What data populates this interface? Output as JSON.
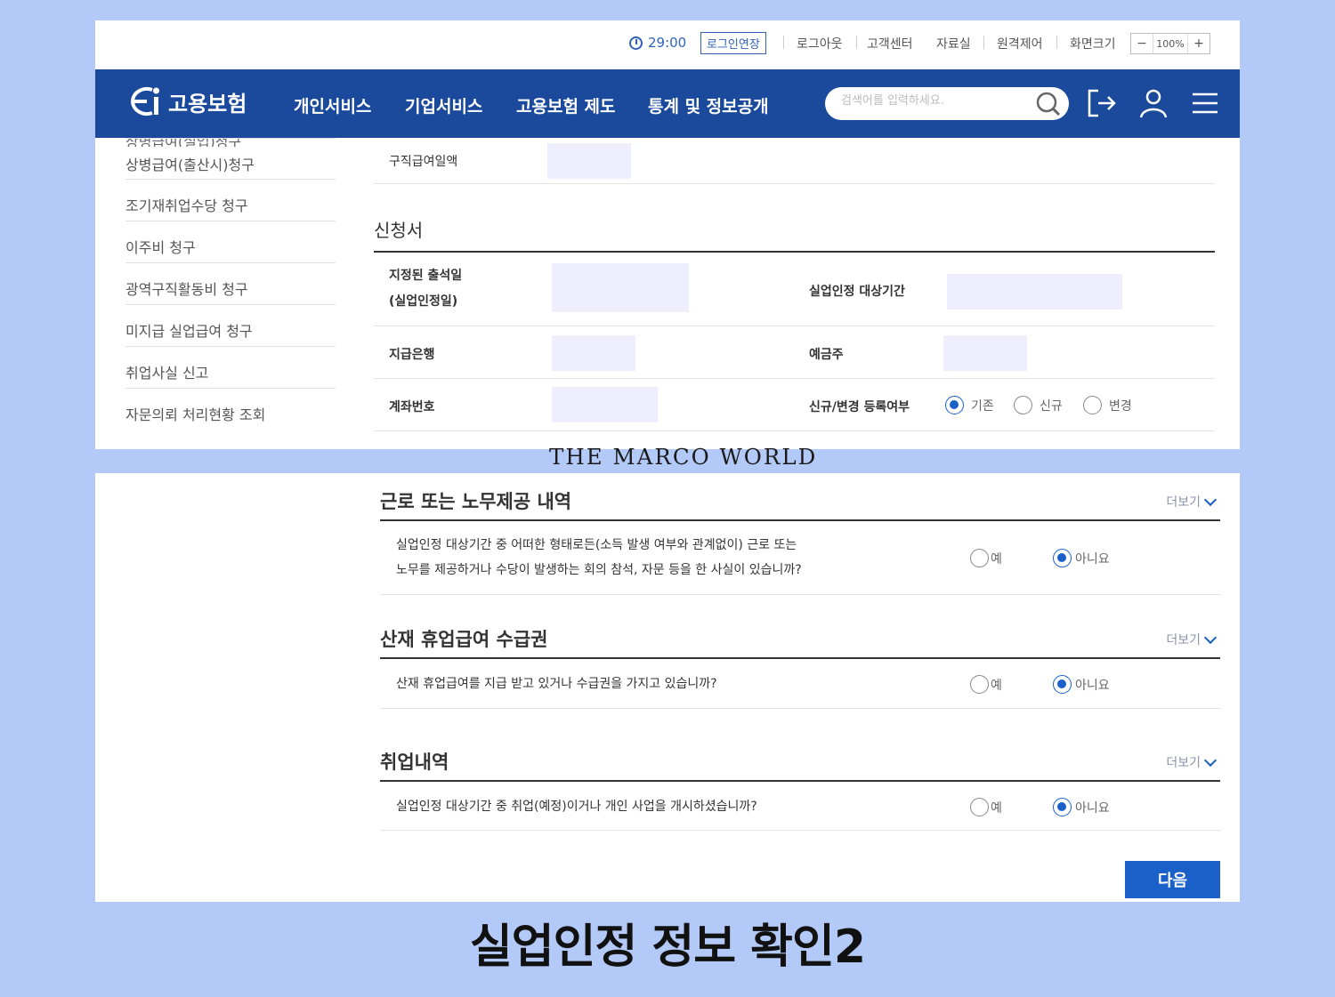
{
  "util": {
    "timer": "29:00",
    "extend": "로그인연장",
    "logout": "로그아웃",
    "customer_center": "고객센터",
    "library": "자료실",
    "remote": "원격제어",
    "screen_size": "화면크기",
    "zoom_minus": "−",
    "zoom_value": "100%",
    "zoom_plus": "+"
  },
  "gnb": {
    "logo_text": "고용보험",
    "menu": [
      "개인서비스",
      "기업서비스",
      "고용보험 제도",
      "통계 및 정보공개"
    ],
    "search_placeholder": "검색어를 입력하세요."
  },
  "lnb": {
    "cut_item": "상병급여(실업)청구",
    "items": [
      "상병급여(출산시)청구",
      "조기재취업수당 청구",
      "이주비 청구",
      "광역구직활동비 청구",
      "미지급 실업급여 청구",
      "취업사실 신고",
      "자문의뢰 처리현황 조회"
    ]
  },
  "form": {
    "daily_amount_label": "구직급여일액",
    "section_title": "신청서",
    "attend_label_1": "지정된 출석일",
    "attend_label_2": "(실업인정일)",
    "period_label": "실업인정 대상기간",
    "bank_label": "지급은행",
    "holder_label": "예금주",
    "account_label": "계좌번호",
    "reg_label": "신규/변경 등록여부",
    "reg_options": [
      "기존",
      "신규",
      "변경"
    ],
    "reg_selected": 0
  },
  "watermark": "THE MARCO WORLD",
  "sections": [
    {
      "title": "근로 또는 노무제공 내역",
      "more": "더보기",
      "question_1": "실업인정 대상기간 중 어떠한 형태로든(소득 발생 여부와 관계없이) 근로 또는",
      "question_2": "노무를 제공하거나 수당이 발생하는 회의 참석, 자문 등을 한 사실이 있습니까?",
      "yes": "예",
      "no": "아니요",
      "selected": "no"
    },
    {
      "title": "산재 휴업급여 수급권",
      "more": "더보기",
      "question_1": "산재 휴업급여를 지급 받고 있거나 수급권을 가지고 있습니까?",
      "yes": "예",
      "no": "아니요",
      "selected": "no"
    },
    {
      "title": "취업내역",
      "more": "더보기",
      "question_1": "실업인정 대상기간 중 취업(예정)이거나 개인 사업을 개시하셨습니까?",
      "yes": "예",
      "no": "아니요",
      "selected": "no"
    }
  ],
  "next_button": "다음",
  "caption": "실업인정 정보 확인2",
  "colors": {
    "nav": "#1b4a9c",
    "accent": "#1b5fc9",
    "background": "#b3c9f7"
  }
}
